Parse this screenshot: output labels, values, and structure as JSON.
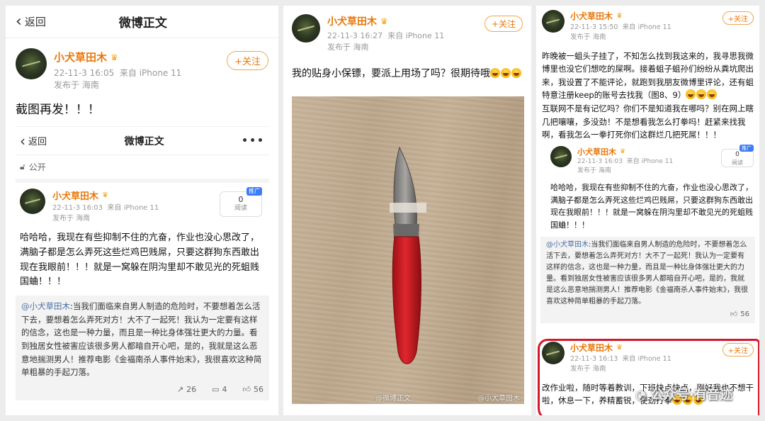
{
  "colors": {
    "username": "#e8780a",
    "follow_border": "#f0a54a",
    "quote_bg": "#f3f3f3",
    "annotation": "#d3182b",
    "tag_blue": "#3c7cf6"
  },
  "panel1": {
    "nav": {
      "back_label": "返回",
      "title": "微博正文",
      "more_icon": "more-dots-icon"
    },
    "post": {
      "author": "小犬草田木",
      "date": "22-11-3 16:05",
      "source": "来自 iPhone 11",
      "location": "发布于 海南",
      "follow_label": "+关注",
      "text": "截图再发！！！"
    },
    "inner": {
      "nav": {
        "back_label": "返回",
        "title": "微博正文"
      },
      "visibility": "公开",
      "author": "小犬草田木",
      "date": "22-11-3 16:03",
      "source": "来自 iPhone 11",
      "location": "发布于 海南",
      "reads": "0",
      "reads_label": "阅读",
      "reads_tag": "推广",
      "text": "哈哈哈，我现在有些抑制不住的亢奋，作业也没心思改了，满脑子都是怎么弄死这些烂鸡巴贱屌，只要这群狗东西敢出现在我眼前！！！就是一窝躲在阴沟里却不敢见光的死蛆贱国蛐！！！",
      "quote_at": "@小犬草田木",
      "quote_text": ":当我们面临来自男人制造的危险时，不要想着怎么活下去，要想着怎么弄死对方！大不了一起死！我认为一定要有这样的信念，这也是一种力量，而且是一种比身体强壮更大的力量。看到独居女性被害应该很多男人都暗自开心吧，是的，我就是这么恶意地揣测男人！推荐电影《金福南杀人事件始末》，我很喜欢这种简单粗暴的手起刀落。",
      "shares": "26",
      "comments": "4",
      "likes": "56"
    }
  },
  "panel2": {
    "post": {
      "author": "小犬草田木",
      "date": "22-11-3 16:27",
      "source": "来自 iPhone 11",
      "location": "发布于 海南",
      "follow_label": "+关注",
      "text": "我的贴身小保镖，要派上用场了吗？很期待哦"
    },
    "photo_watermark_left": "@微博正文",
    "photo_watermark_right": "@小犬草田木"
  },
  "panel3": {
    "post": {
      "author": "小犬草田木",
      "date": "22-11-3 15:50",
      "source": "来自 iPhone 11",
      "location": "发布于 海南",
      "follow_label": "+关注",
      "text_a": "昨晚被一蛆头子挂了，不知怎么找到我这来的，我寻思我微博里也没它们想吃的屎啊。接着蛆子蛆孙们纷纷从粪坑爬出来，我设置了不能评论，就跑到我朋友微博里评论，还有蛆特意注册keep的账号去找我（图8、9）",
      "text_b": "互联网不是有记忆吗？你们不是知道我在哪吗？别在网上瞎几把嚷嚷，多没劲！不是想看我怎么打拳吗！赶紧来找我啊，看我怎么一拳打死你们这群烂几把死屌！！！"
    },
    "inner": {
      "author": "小犬草田木",
      "date": "22-11-3 16:03",
      "source": "来自 iPhone 11",
      "location": "发布于 海南",
      "reads": "0",
      "reads_label": "阅读",
      "reads_tag": "推广",
      "text": "哈哈哈，我现在有些抑制不住的亢奋，作业也没心思改了，满脑子都是怎么弄死这些烂鸡巴贱屌，只要这群狗东西敢出现在我眼前！！！就是一窝躲在阴沟里却不敢见光的死蛆贱国蛐！！！",
      "quote_at": "@小犬草田木",
      "quote_text": ":当我们面临来自男人制造的危险时，不要想着怎么活下去，要想着怎么弄死对方！大不了一起死！我认为一定要有这样的信念，这也是一种力量，而且是一种比身体强壮更大的力量。看到独居女性被害应该很多男人都暗自开心吧，是的，我就是这么恶意地揣测男人！推荐电影《金福南杀人事件始末》，我很喜欢这种简单粗暴的手起刀落。",
      "likes": "56"
    },
    "highlighted": {
      "author": "小犬草田木",
      "date": "22-11-3 16:13",
      "source": "来自 iPhone 11",
      "location": "发布于 海南",
      "follow_label": "+关注",
      "text": "改作业啦，随时等着教训，下班快点快点，刚好我也不想干啦，休息一下，养精蓄锐，使劲打拳"
    },
    "watermark": "公众号·有音迹"
  }
}
